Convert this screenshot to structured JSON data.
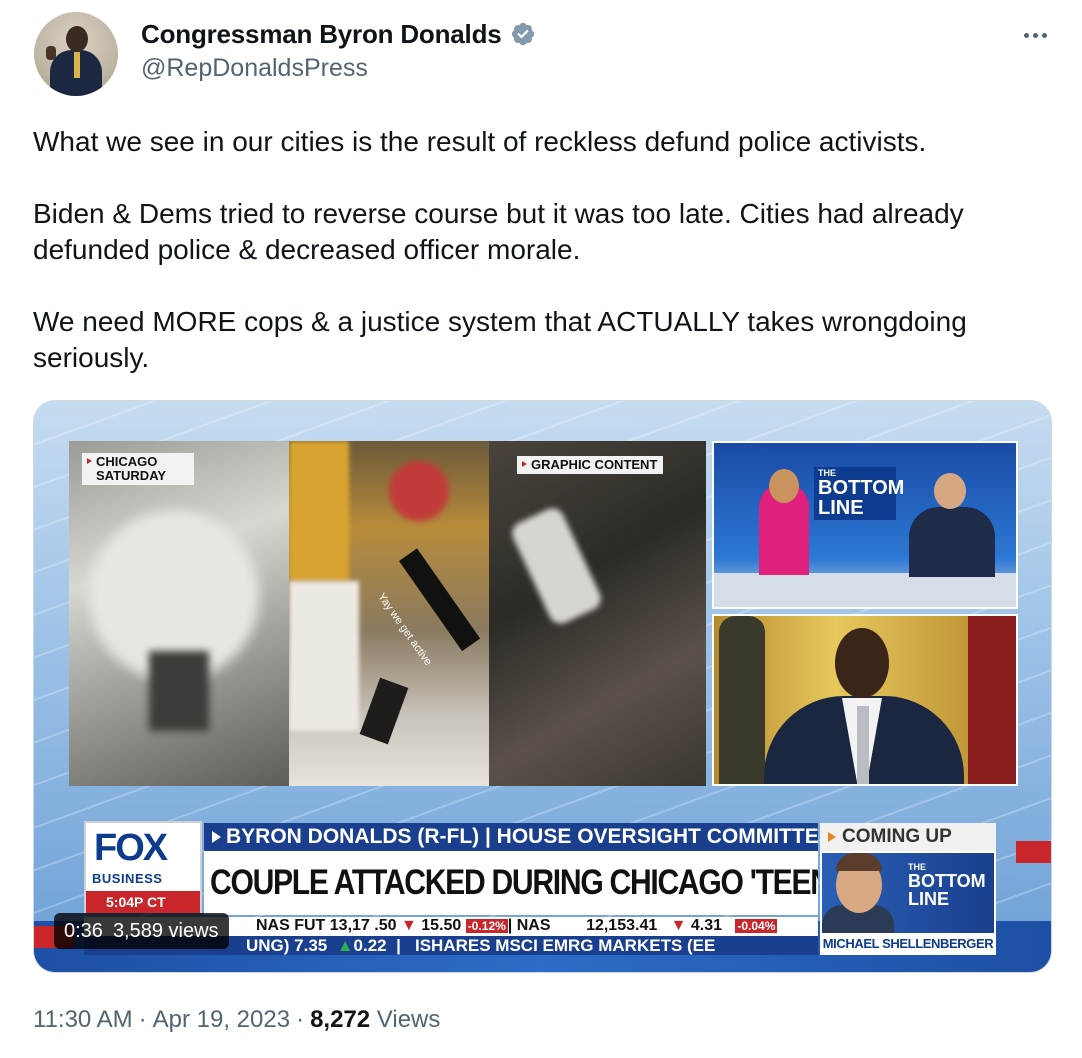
{
  "author": {
    "display_name": "Congressman Byron Donalds",
    "handle": "@RepDonaldsPress",
    "verified": true,
    "verified_color": "#829aab"
  },
  "tweet": {
    "paragraphs": [
      "What we see in our cities is the result of reckless defund police activists.",
      "Biden & Dems tried to reverse course but it was too late. Cities had already defunded police & decreased officer morale.",
      "We need MORE cops & a justice system that ACTUALLY takes wrongdoing seriously."
    ]
  },
  "media": {
    "tag_chicago": "CHICAGO SATURDAY",
    "tag_graphic": "GRAPHIC CONTENT",
    "video_caption": "Yay we get active",
    "studio_logo": {
      "the": "THE",
      "main": "BOTTOM LINE"
    },
    "fox_logo": {
      "fox": "FOX",
      "business": "BUSINESS",
      "time": "5:04P CT"
    },
    "lower_third_top": "BYRON DONALDS (R-FL) | HOUSE OVERSIGHT COMMITTEE",
    "lower_third_main": "COUPLE ATTACKED DURING CHICAGO 'TEEN TAKEOVER'",
    "coming_up": "COMING UP",
    "coming_up_guest": "MICHAEL SHELLENBERGER",
    "ticker": {
      "row1_a": "NAS FUT 13,17",
      "row1_b": ".50",
      "row1_c": "15.50",
      "row1_d": "-0.12%",
      "row1_e": "NAS",
      "row1_f": "12,153.41",
      "row1_g": "4.31",
      "row1_h": "-0.04%",
      "row2_a": "UNG) 7.35",
      "row2_b": "0.22",
      "row2_c": "ISHARES MSCI EMRG MARKETS (EE"
    },
    "duration": "0:36",
    "views": "3,589 views"
  },
  "footer": {
    "time": "11:30 AM",
    "date": "Apr 19, 2023",
    "views_count": "8,272",
    "views_label": "Views"
  },
  "colors": {
    "text": "#0f1419",
    "secondary": "#536471",
    "fox_blue": "#1a3f8f",
    "fox_red": "#c8262b"
  },
  "icons": [
    "verified-badge-icon",
    "more-options-icon"
  ]
}
